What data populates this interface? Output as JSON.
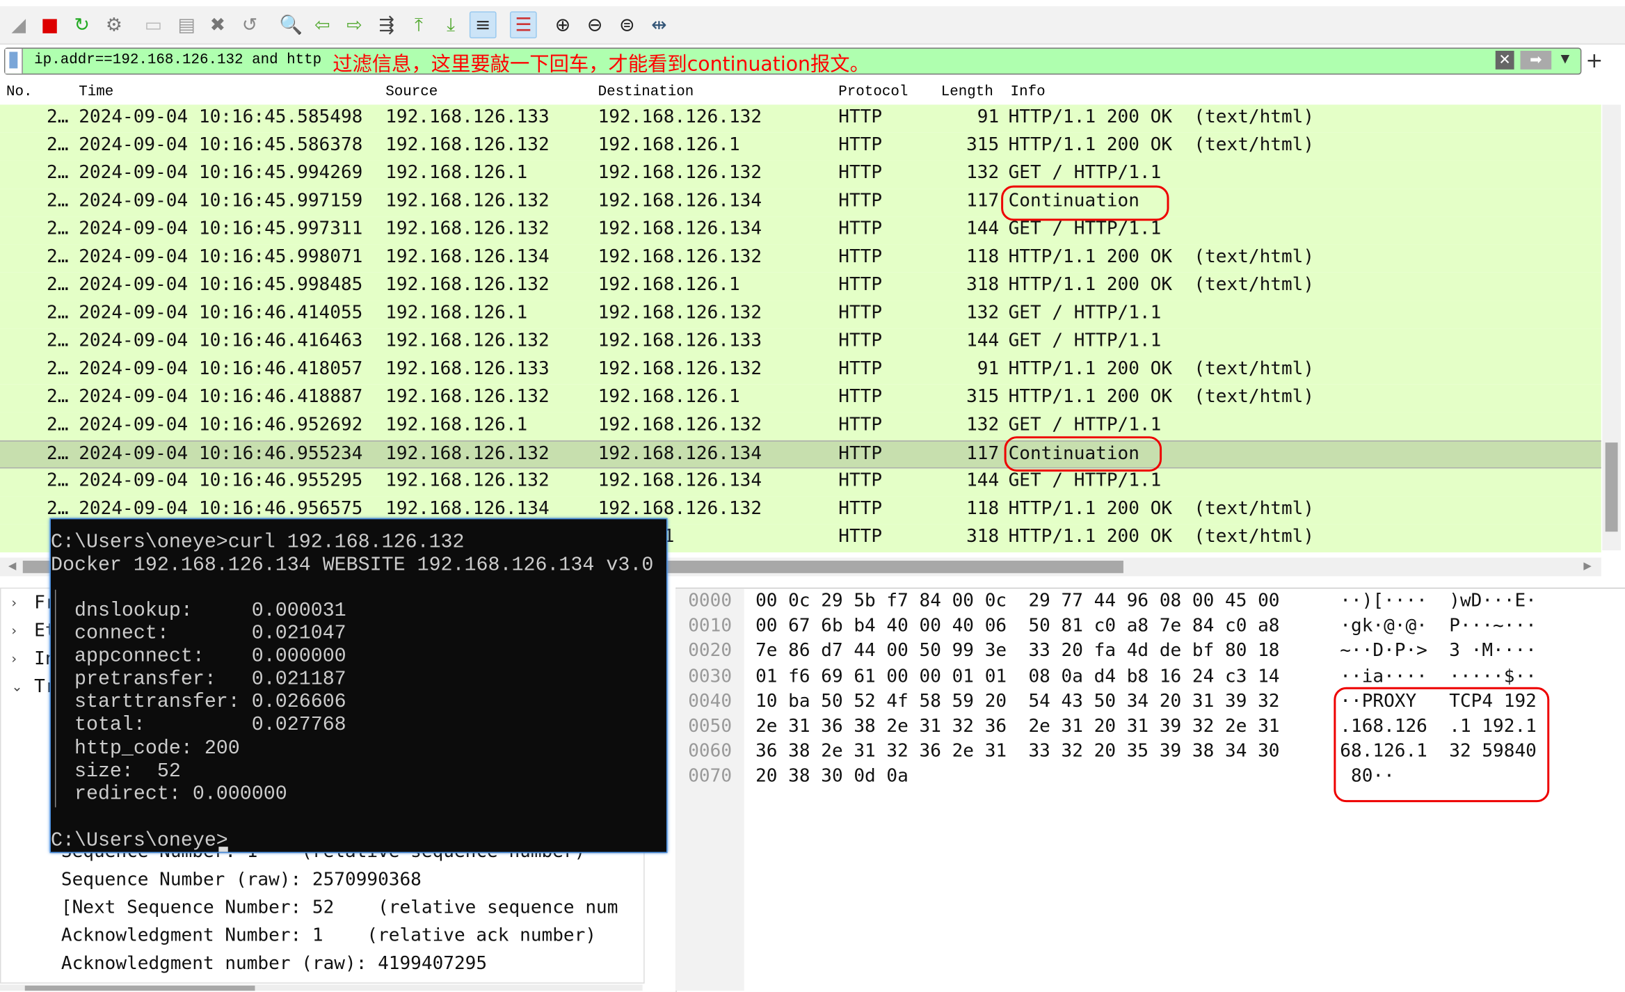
{
  "toolbar": {
    "icons": [
      "shark-fin-start-icon",
      "stop-capture-icon",
      "restart-capture-icon",
      "capture-options-icon",
      "open-file-icon",
      "save-file-icon",
      "close-file-icon",
      "reload-file-icon",
      "find-packet-icon",
      "go-back-icon",
      "go-forward-icon",
      "go-to-packet-icon",
      "first-packet-icon",
      "last-packet-icon",
      "autoscroll-icon",
      "colorize-icon",
      "zoom-in-icon",
      "zoom-out-icon",
      "normal-size-icon",
      "resize-columns-icon"
    ]
  },
  "filter": {
    "value": "ip.addr==192.168.126.132 and http",
    "annotation": "过滤信息，这里要敲一下回车，才能看到continuation报文。",
    "bg": "#afffaf"
  },
  "columns": [
    "No.",
    "Time",
    "Source",
    "Destination",
    "Protocol",
    "Length",
    "Info"
  ],
  "packets": [
    {
      "no": "2…",
      "time": "2024-09-04 10:16:45.585498",
      "src": "192.168.126.133",
      "dst": "192.168.126.132",
      "proto": "HTTP",
      "len": "91",
      "info": "HTTP/1.1 200 OK  (text/html)"
    },
    {
      "no": "2…",
      "time": "2024-09-04 10:16:45.586378",
      "src": "192.168.126.132",
      "dst": "192.168.126.1",
      "proto": "HTTP",
      "len": "315",
      "info": "HTTP/1.1 200 OK  (text/html)"
    },
    {
      "no": "2…",
      "time": "2024-09-04 10:16:45.994269",
      "src": "192.168.126.1",
      "dst": "192.168.126.132",
      "proto": "HTTP",
      "len": "132",
      "info": "GET / HTTP/1.1"
    },
    {
      "no": "2…",
      "time": "2024-09-04 10:16:45.997159",
      "src": "192.168.126.132",
      "dst": "192.168.126.134",
      "proto": "HTTP",
      "len": "117",
      "info": "Continuation"
    },
    {
      "no": "2…",
      "time": "2024-09-04 10:16:45.997311",
      "src": "192.168.126.132",
      "dst": "192.168.126.134",
      "proto": "HTTP",
      "len": "144",
      "info": "GET / HTTP/1.1"
    },
    {
      "no": "2…",
      "time": "2024-09-04 10:16:45.998071",
      "src": "192.168.126.134",
      "dst": "192.168.126.132",
      "proto": "HTTP",
      "len": "118",
      "info": "HTTP/1.1 200 OK  (text/html)"
    },
    {
      "no": "2…",
      "time": "2024-09-04 10:16:45.998485",
      "src": "192.168.126.132",
      "dst": "192.168.126.1",
      "proto": "HTTP",
      "len": "318",
      "info": "HTTP/1.1 200 OK  (text/html)"
    },
    {
      "no": "2…",
      "time": "2024-09-04 10:16:46.414055",
      "src": "192.168.126.1",
      "dst": "192.168.126.132",
      "proto": "HTTP",
      "len": "132",
      "info": "GET / HTTP/1.1"
    },
    {
      "no": "2…",
      "time": "2024-09-04 10:16:46.416463",
      "src": "192.168.126.132",
      "dst": "192.168.126.133",
      "proto": "HTTP",
      "len": "144",
      "info": "GET / HTTP/1.1"
    },
    {
      "no": "2…",
      "time": "2024-09-04 10:16:46.418057",
      "src": "192.168.126.133",
      "dst": "192.168.126.132",
      "proto": "HTTP",
      "len": "91",
      "info": "HTTP/1.1 200 OK  (text/html)"
    },
    {
      "no": "2…",
      "time": "2024-09-04 10:16:46.418887",
      "src": "192.168.126.132",
      "dst": "192.168.126.1",
      "proto": "HTTP",
      "len": "315",
      "info": "HTTP/1.1 200 OK  (text/html)"
    },
    {
      "no": "2…",
      "time": "2024-09-04 10:16:46.952692",
      "src": "192.168.126.1",
      "dst": "192.168.126.132",
      "proto": "HTTP",
      "len": "132",
      "info": "GET / HTTP/1.1"
    },
    {
      "no": "2…",
      "time": "2024-09-04 10:16:46.955234",
      "src": "192.168.126.132",
      "dst": "192.168.126.134",
      "proto": "HTTP",
      "len": "117",
      "info": "Continuation",
      "selected": true
    },
    {
      "no": "2…",
      "time": "2024-09-04 10:16:46.955295",
      "src": "192.168.126.132",
      "dst": "192.168.126.134",
      "proto": "HTTP",
      "len": "144",
      "info": "GET / HTTP/1.1"
    },
    {
      "no": "2…",
      "time": "2024-09-04 10:16:46.956575",
      "src": "192.168.126.134",
      "dst": "192.168.126.132",
      "proto": "HTTP",
      "len": "118",
      "info": "HTTP/1.1 200 OK  (text/html)"
    },
    {
      "no": "",
      "time": "",
      "src": "",
      "dst": "8.126.1",
      "proto": "HTTP",
      "len": "318",
      "info": "HTTP/1.1 200 OK  (text/html)"
    }
  ],
  "details": {
    "tree": [
      "Fr",
      "Et",
      "In",
      "Tr"
    ],
    "lines": [
      "Sequence Number: 1    (relative sequence number)",
      "Sequence Number (raw): 2570990368",
      "[Next Sequence Number: 52    (relative sequence num",
      "Acknowledgment Number: 1    (relative ack number)",
      "Acknowledgment number (raw): 4199407295"
    ]
  },
  "hex": [
    {
      "off": "0000",
      "bytes": "00 0c 29 5b f7 84 00 0c  29 77 44 96 08 00 45 00",
      "ascii": "··)[····  )wD···E·"
    },
    {
      "off": "0010",
      "bytes": "00 67 6b b4 40 00 40 06  50 81 c0 a8 7e 84 c0 a8",
      "ascii": "·gk·@·@·  P···~···"
    },
    {
      "off": "0020",
      "bytes": "7e 86 d7 44 00 50 99 3e  33 20 fa 4d de bf 80 18",
      "ascii": "~··D·P·>  3 ·M····"
    },
    {
      "off": "0030",
      "bytes": "01 f6 69 61 00 00 01 01  08 0a d4 b8 16 24 c3 14",
      "ascii": "··ia····  ·····$··"
    },
    {
      "off": "0040",
      "bytes": "10 ba 50 52 4f 58 59 20  54 43 50 34 20 31 39 32",
      "ascii": "··PROXY   TCP4 192"
    },
    {
      "off": "0050",
      "bytes": "2e 31 36 38 2e 31 32 36  2e 31 20 31 39 32 2e 31",
      "ascii": ".168.126  .1 192.1"
    },
    {
      "off": "0060",
      "bytes": "36 38 2e 31 32 36 2e 31  33 32 20 35 39 38 34 30",
      "ascii": "68.126.1  32 59840"
    },
    {
      "off": "0070",
      "bytes": "20 38 30 0d 0a",
      "ascii": " 80··"
    }
  ],
  "terminal": {
    "lines": [
      "C:\\Users\\oneye>curl 192.168.126.132",
      "Docker 192.168.126.134 WEBSITE 192.168.126.134 v3.0",
      "",
      "  dnslookup:     0.000031",
      "  connect:       0.021047",
      "  appconnect:    0.000000",
      "  pretransfer:   0.021187",
      "  starttransfer: 0.026606",
      "  total:         0.027768",
      "  http_code: 200",
      "  size:  52",
      "  redirect: 0.000000",
      "",
      "C:\\Users\\oneye>"
    ]
  },
  "colors": {
    "row": "#e4ffc7",
    "selected_row": "#c7dfae",
    "annotation": "#ee0000",
    "terminal_bg": "#0c0c0c"
  }
}
